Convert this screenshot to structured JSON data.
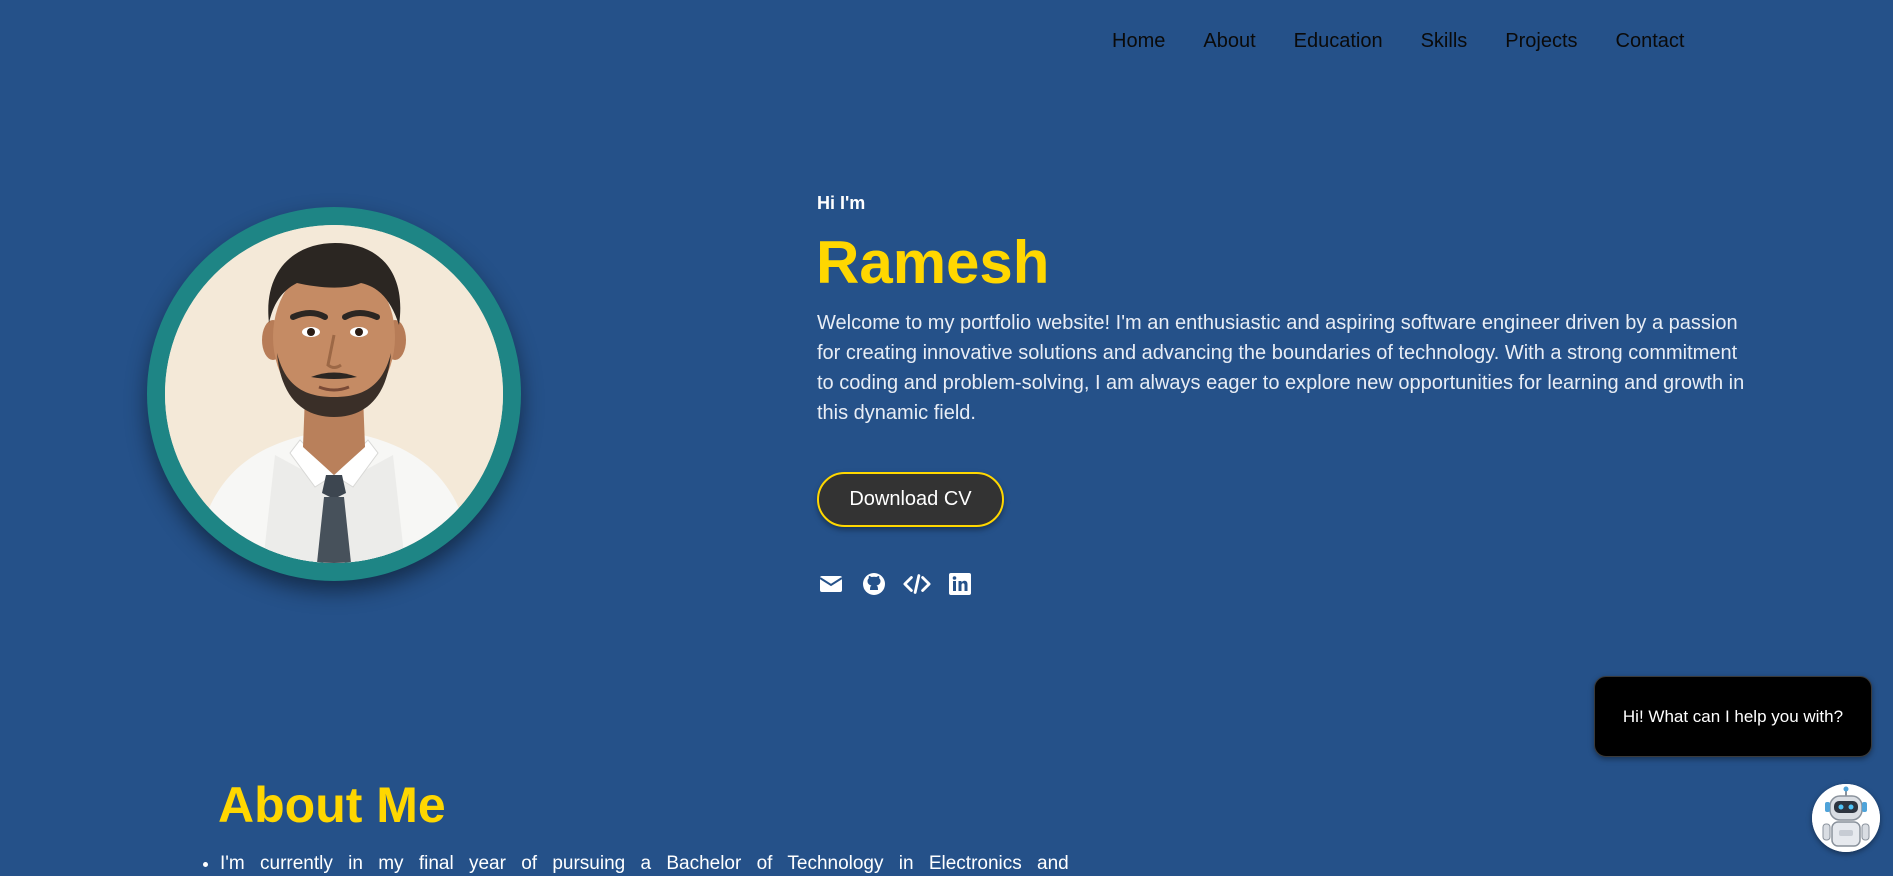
{
  "nav": {
    "items": [
      {
        "label": "Home"
      },
      {
        "label": "About"
      },
      {
        "label": "Education"
      },
      {
        "label": "Skills"
      },
      {
        "label": "Projects"
      },
      {
        "label": "Contact"
      }
    ]
  },
  "hero": {
    "greeting": "Hi I'm",
    "name": "Ramesh",
    "intro": "Welcome to my portfolio website! I'm an enthusiastic and aspiring software engineer driven by a passion for creating innovative solutions and advancing the boundaries of technology. With a strong commitment to coding and problem-solving, I am always eager to explore new opportunities for learning and growth in this dynamic field.",
    "cv_button": "Download CV",
    "socials": [
      {
        "icon": "envelope-icon"
      },
      {
        "icon": "github-icon"
      },
      {
        "icon": "code-icon"
      },
      {
        "icon": "linkedin-icon"
      }
    ]
  },
  "about": {
    "title": "About Me",
    "items": [
      "I'm currently in my final year of pursuing a Bachelor of Technology in Electronics and"
    ]
  },
  "chat": {
    "message": "Hi! What can I help you with?",
    "bot_icon": "chatbot-robot-icon"
  },
  "colors": {
    "background": "#255189",
    "accent": "#ffd700",
    "ring": "#1e8585",
    "button": "#333333"
  }
}
